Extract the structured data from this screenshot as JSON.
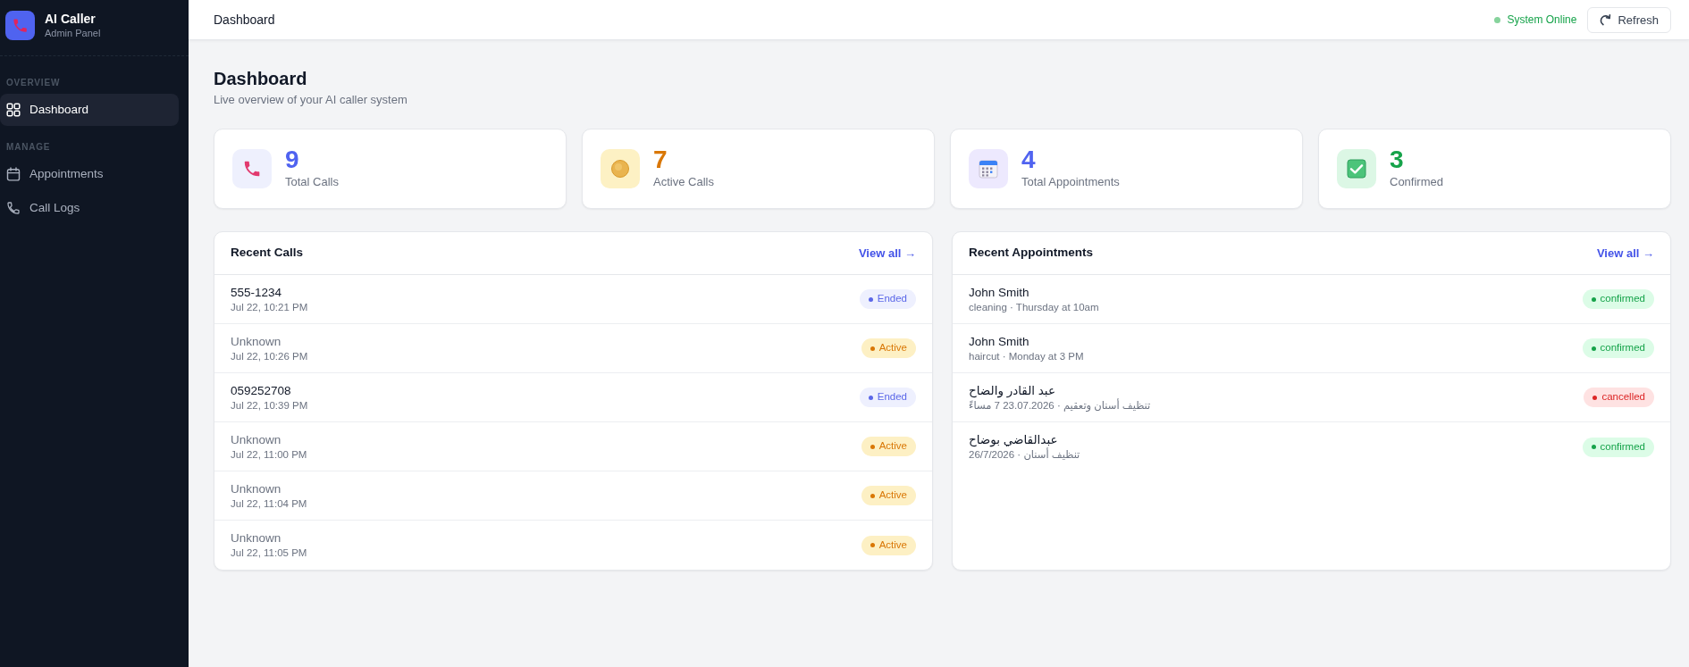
{
  "sidebar": {
    "brand": {
      "title": "AI Caller",
      "subtitle": "Admin Panel"
    },
    "sections": [
      {
        "heading": "OVERVIEW",
        "items": [
          {
            "label": "Dashboard",
            "kind": "grid",
            "selected": true
          }
        ]
      },
      {
        "heading": "MANAGE",
        "items": [
          {
            "label": "Appointments",
            "kind": "calendar",
            "selected": false
          },
          {
            "label": "Call Logs",
            "kind": "phone",
            "selected": false
          }
        ]
      }
    ]
  },
  "topbar": {
    "title": "Dashboard",
    "status": {
      "label": "System Online",
      "online": true
    },
    "refresh_button": "Refresh"
  },
  "header": {
    "title": "Dashboard",
    "subtitle": "Live overview of your AI caller system"
  },
  "stats": [
    {
      "kind": "calls",
      "value": "9",
      "label": "Total Calls",
      "color": "#5063f0"
    },
    {
      "kind": "active",
      "value": "7",
      "label": "Active Calls",
      "color": "#d97706"
    },
    {
      "kind": "appointments",
      "value": "4",
      "label": "Total Appointments",
      "color": "#5063f0"
    },
    {
      "kind": "confirmed",
      "value": "3",
      "label": "Confirmed",
      "color": "#16a34a"
    }
  ],
  "recent_calls": {
    "title": "Recent Calls",
    "link": "View all →",
    "rows": [
      {
        "caller": "555-1234",
        "unknown": false,
        "time": "Jul 22, 10:21 PM",
        "status": "Ended",
        "kind": "ended"
      },
      {
        "caller": "Unknown",
        "unknown": true,
        "time": "Jul 22, 10:26 PM",
        "status": "Active",
        "kind": "active"
      },
      {
        "caller": "059252708",
        "unknown": false,
        "time": "Jul 22, 10:39 PM",
        "status": "Ended",
        "kind": "ended"
      },
      {
        "caller": "Unknown",
        "unknown": true,
        "time": "Jul 22, 11:00 PM",
        "status": "Active",
        "kind": "active"
      },
      {
        "caller": "Unknown",
        "unknown": true,
        "time": "Jul 22, 11:04 PM",
        "status": "Active",
        "kind": "active"
      },
      {
        "caller": "Unknown",
        "unknown": true,
        "time": "Jul 22, 11:05 PM",
        "status": "Active",
        "kind": "active"
      }
    ]
  },
  "recent_appointments": {
    "title": "Recent Appointments",
    "link": "View all →",
    "rows": [
      {
        "name": "John Smith",
        "detail": "cleaning · Thursday at 10am",
        "status": "confirmed",
        "kind": "confirmed"
      },
      {
        "name": "John Smith",
        "detail": "haircut · Monday at 3 PM",
        "status": "confirmed",
        "kind": "confirmed"
      },
      {
        "name": "عبد القادر والضاح",
        "detail": "تنظيف أسنان وتعقيم · 23.07.2026 7 مساءً",
        "status": "cancelled",
        "kind": "cancelled"
      },
      {
        "name": "عبدالقاضي بوضاح",
        "detail": "تنظيف أسنان · 26/7/2026",
        "status": "confirmed",
        "kind": "confirmed"
      }
    ]
  }
}
